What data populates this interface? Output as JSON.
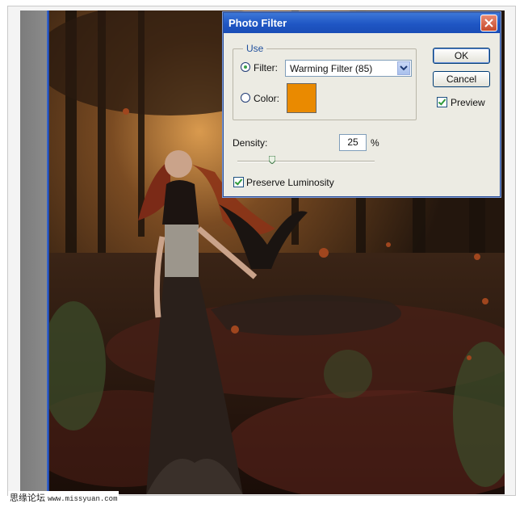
{
  "dialog": {
    "title": "Photo Filter",
    "use_group_label": "Use",
    "filter_label": "Filter:",
    "filter_value": "Warming Filter (85)",
    "color_label": "Color:",
    "color_swatch": "#ea8a00",
    "ok_label": "OK",
    "cancel_label": "Cancel",
    "preview_label": "Preview",
    "preview_checked": true,
    "density_label": "Density:",
    "density_value": "25",
    "density_unit": "%",
    "density_level": 0.25,
    "preserve_label": "Preserve Luminosity",
    "preserve_checked": true
  },
  "watermark": {
    "site_cn": "思缘论坛",
    "site_url": "www.missyuan.com"
  },
  "colors": {
    "titlebar": "#1f56c4",
    "dialog_bg": "#ecebe3",
    "accent": "#1f4f9d"
  }
}
